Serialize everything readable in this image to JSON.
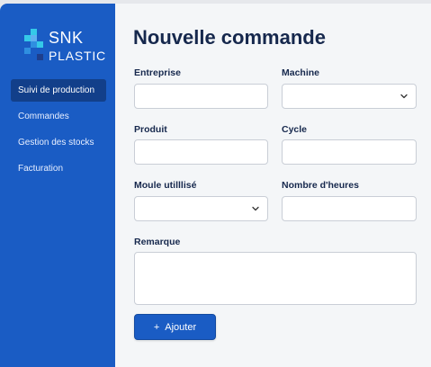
{
  "brand": {
    "line1": "SNK",
    "line2": "PLASTIC",
    "logo_icon": "pixel-squares-logo",
    "colors": {
      "sidebar": "#1a5cc4",
      "logo_accent": "#35c9e8"
    }
  },
  "sidebar": {
    "items": [
      {
        "label": "Suivi de production",
        "active": true
      },
      {
        "label": "Commandes",
        "active": false
      },
      {
        "label": "Gestion des stocks",
        "active": false
      },
      {
        "label": "Facturation",
        "active": false
      }
    ]
  },
  "form": {
    "title": "Nouvelle commande",
    "entreprise": {
      "label": "Entreprise",
      "value": ""
    },
    "machine": {
      "label": "Machine",
      "value": "",
      "icon": "chevron-down-icon"
    },
    "produit": {
      "label": "Produit",
      "value": ""
    },
    "cycle": {
      "label": "Cycle",
      "value": ""
    },
    "moule": {
      "label": "Moule utilllisé",
      "value": "",
      "icon": "chevron-down-icon"
    },
    "heures": {
      "label": "Nombre d'heures",
      "value": ""
    },
    "remarque": {
      "label": "Remarque",
      "value": ""
    },
    "submit": {
      "icon": "+",
      "label": "Ajouter"
    }
  }
}
